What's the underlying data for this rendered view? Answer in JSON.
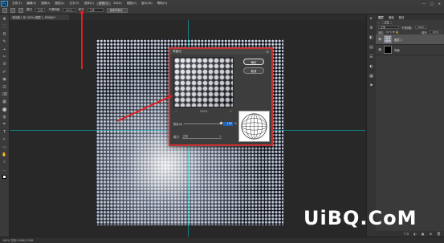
{
  "menubar": {
    "logo": "Ps",
    "items": [
      "文件(F)",
      "编辑(E)",
      "图像(I)",
      "图层(L)",
      "文字(Y)",
      "选择(S)",
      "滤镜(T)",
      "3D(D)",
      "视图(V)",
      "窗口(W)",
      "帮助(H)"
    ],
    "active_index": 6,
    "window_controls": [
      "—",
      "□",
      "✕"
    ]
  },
  "options": {
    "tool_label": "模式",
    "mode_value": "正常",
    "opacity_label": "不透明度",
    "opacity_value": "100%",
    "style_label": "样式",
    "style_value": "正常",
    "refine_button": "选择并遮住..."
  },
  "document": {
    "tab_title": "未标题-1 @ 100% (图层 1, RGB/8) *"
  },
  "tools": [
    "✥",
    "⬚",
    "ʘ",
    "✎",
    "⌖",
    "✂",
    "⊘",
    "✐",
    "◉",
    "⎚",
    "⌫",
    "▦",
    "⬤",
    "◍",
    "✒",
    "T",
    "↖",
    "▭",
    "✋",
    "⌕",
    "…"
  ],
  "status": {
    "text": "100%   文档:3.00M/3.00M"
  },
  "right_panel_icons": [
    "▸",
    "⚙",
    "◧",
    "▤",
    "☰",
    "◐",
    "▦",
    "⚑"
  ],
  "layers_panel": {
    "tabs": [
      "图层",
      "通道",
      "路径"
    ],
    "kind_label": "类型",
    "blend_mode": "正常",
    "opacity_label": "不透明度:",
    "opacity_value": "100%",
    "lock_label": "锁定:",
    "fill_label": "填充:",
    "fill_value": "100%",
    "layers": [
      {
        "name": "图层 1",
        "thumb": "pattern",
        "selected": true
      },
      {
        "name": "背景",
        "thumb": "black",
        "selected": false
      }
    ],
    "bottom_icons": [
      "ⓕx",
      "◐",
      "▣",
      "⊞",
      "🗑"
    ]
  },
  "dialog": {
    "title": "球面化",
    "close": "✕",
    "ok_label": "确定",
    "cancel_label": "取消",
    "zoom_out": "−",
    "zoom_level": "100%",
    "zoom_in": "+",
    "amount_label": "数量(A)",
    "amount_value": "100",
    "amount_unit": "%",
    "amount_fraction": 1.0,
    "mode_label": "模式:",
    "mode_value": "正常"
  },
  "watermark": "UiBQ.CoM"
}
